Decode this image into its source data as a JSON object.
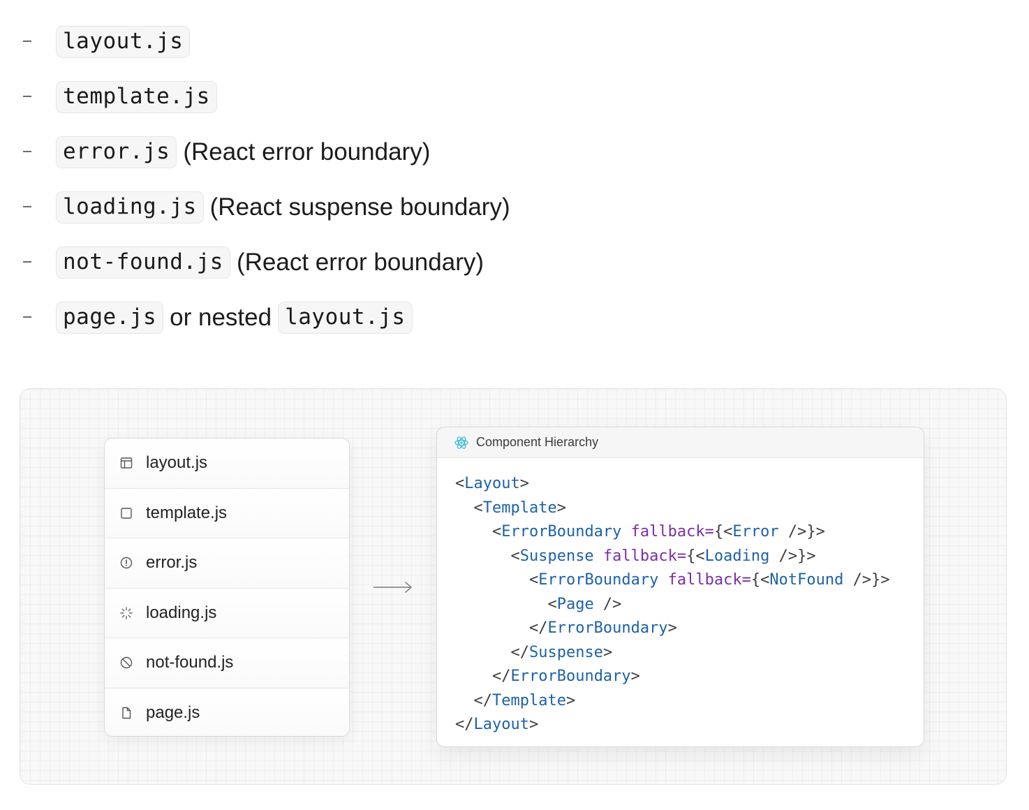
{
  "bullets": [
    {
      "parts": [
        {
          "type": "code",
          "text": "layout.js"
        }
      ]
    },
    {
      "parts": [
        {
          "type": "code",
          "text": "template.js"
        }
      ]
    },
    {
      "parts": [
        {
          "type": "code",
          "text": "error.js"
        },
        {
          "type": "text",
          "text": "(React error boundary)"
        }
      ]
    },
    {
      "parts": [
        {
          "type": "code",
          "text": "loading.js"
        },
        {
          "type": "text",
          "text": "(React suspense boundary)"
        }
      ]
    },
    {
      "parts": [
        {
          "type": "code",
          "text": "not-found.js"
        },
        {
          "type": "text",
          "text": "(React error boundary)"
        }
      ]
    },
    {
      "parts": [
        {
          "type": "code",
          "text": "page.js"
        },
        {
          "type": "text",
          "text": "or nested"
        },
        {
          "type": "code",
          "text": "layout.js"
        }
      ]
    }
  ],
  "files": [
    {
      "name": "layout.js",
      "icon": "layout-icon"
    },
    {
      "name": "template.js",
      "icon": "square-icon"
    },
    {
      "name": "error.js",
      "icon": "alert-circle-icon"
    },
    {
      "name": "loading.js",
      "icon": "spinner-icon"
    },
    {
      "name": "not-found.js",
      "icon": "ban-icon"
    },
    {
      "name": "page.js",
      "icon": "file-icon"
    }
  ],
  "hierarchy": {
    "title": "Component Hierarchy",
    "icon": "react-icon",
    "lines": [
      [
        {
          "c": "p",
          "t": "<"
        },
        {
          "c": "t",
          "t": "Layout"
        },
        {
          "c": "p",
          "t": ">"
        }
      ],
      [
        {
          "c": "p",
          "t": "  <"
        },
        {
          "c": "t",
          "t": "Template"
        },
        {
          "c": "p",
          "t": ">"
        }
      ],
      [
        {
          "c": "p",
          "t": "    <"
        },
        {
          "c": "t",
          "t": "ErrorBoundary"
        },
        {
          "c": "p",
          "t": " "
        },
        {
          "c": "a",
          "t": "fallback="
        },
        {
          "c": "p",
          "t": "{<"
        },
        {
          "c": "t",
          "t": "Error"
        },
        {
          "c": "p",
          "t": " />}>"
        }
      ],
      [
        {
          "c": "p",
          "t": "      <"
        },
        {
          "c": "t",
          "t": "Suspense"
        },
        {
          "c": "p",
          "t": " "
        },
        {
          "c": "a",
          "t": "fallback="
        },
        {
          "c": "p",
          "t": "{<"
        },
        {
          "c": "t",
          "t": "Loading"
        },
        {
          "c": "p",
          "t": " />}>"
        }
      ],
      [
        {
          "c": "p",
          "t": "        <"
        },
        {
          "c": "t",
          "t": "ErrorBoundary"
        },
        {
          "c": "p",
          "t": " "
        },
        {
          "c": "a",
          "t": "fallback="
        },
        {
          "c": "p",
          "t": "{<"
        },
        {
          "c": "t",
          "t": "NotFound"
        },
        {
          "c": "p",
          "t": " />}>"
        }
      ],
      [
        {
          "c": "p",
          "t": "          <"
        },
        {
          "c": "t",
          "t": "Page"
        },
        {
          "c": "p",
          "t": " />"
        }
      ],
      [
        {
          "c": "p",
          "t": "        </"
        },
        {
          "c": "t",
          "t": "ErrorBoundary"
        },
        {
          "c": "p",
          "t": ">"
        }
      ],
      [
        {
          "c": "p",
          "t": "      </"
        },
        {
          "c": "t",
          "t": "Suspense"
        },
        {
          "c": "p",
          "t": ">"
        }
      ],
      [
        {
          "c": "p",
          "t": "    </"
        },
        {
          "c": "t",
          "t": "ErrorBoundary"
        },
        {
          "c": "p",
          "t": ">"
        }
      ],
      [
        {
          "c": "p",
          "t": "  </"
        },
        {
          "c": "t",
          "t": "Template"
        },
        {
          "c": "p",
          "t": ">"
        }
      ],
      [
        {
          "c": "p",
          "t": "</"
        },
        {
          "c": "t",
          "t": "Layout"
        },
        {
          "c": "p",
          "t": ">"
        }
      ]
    ]
  },
  "colors": {
    "tag_name": "#1d61a8",
    "attribute": "#7b2fa6",
    "punctuation": "#3d3d3d",
    "react_logo": "#2fb8d8"
  }
}
